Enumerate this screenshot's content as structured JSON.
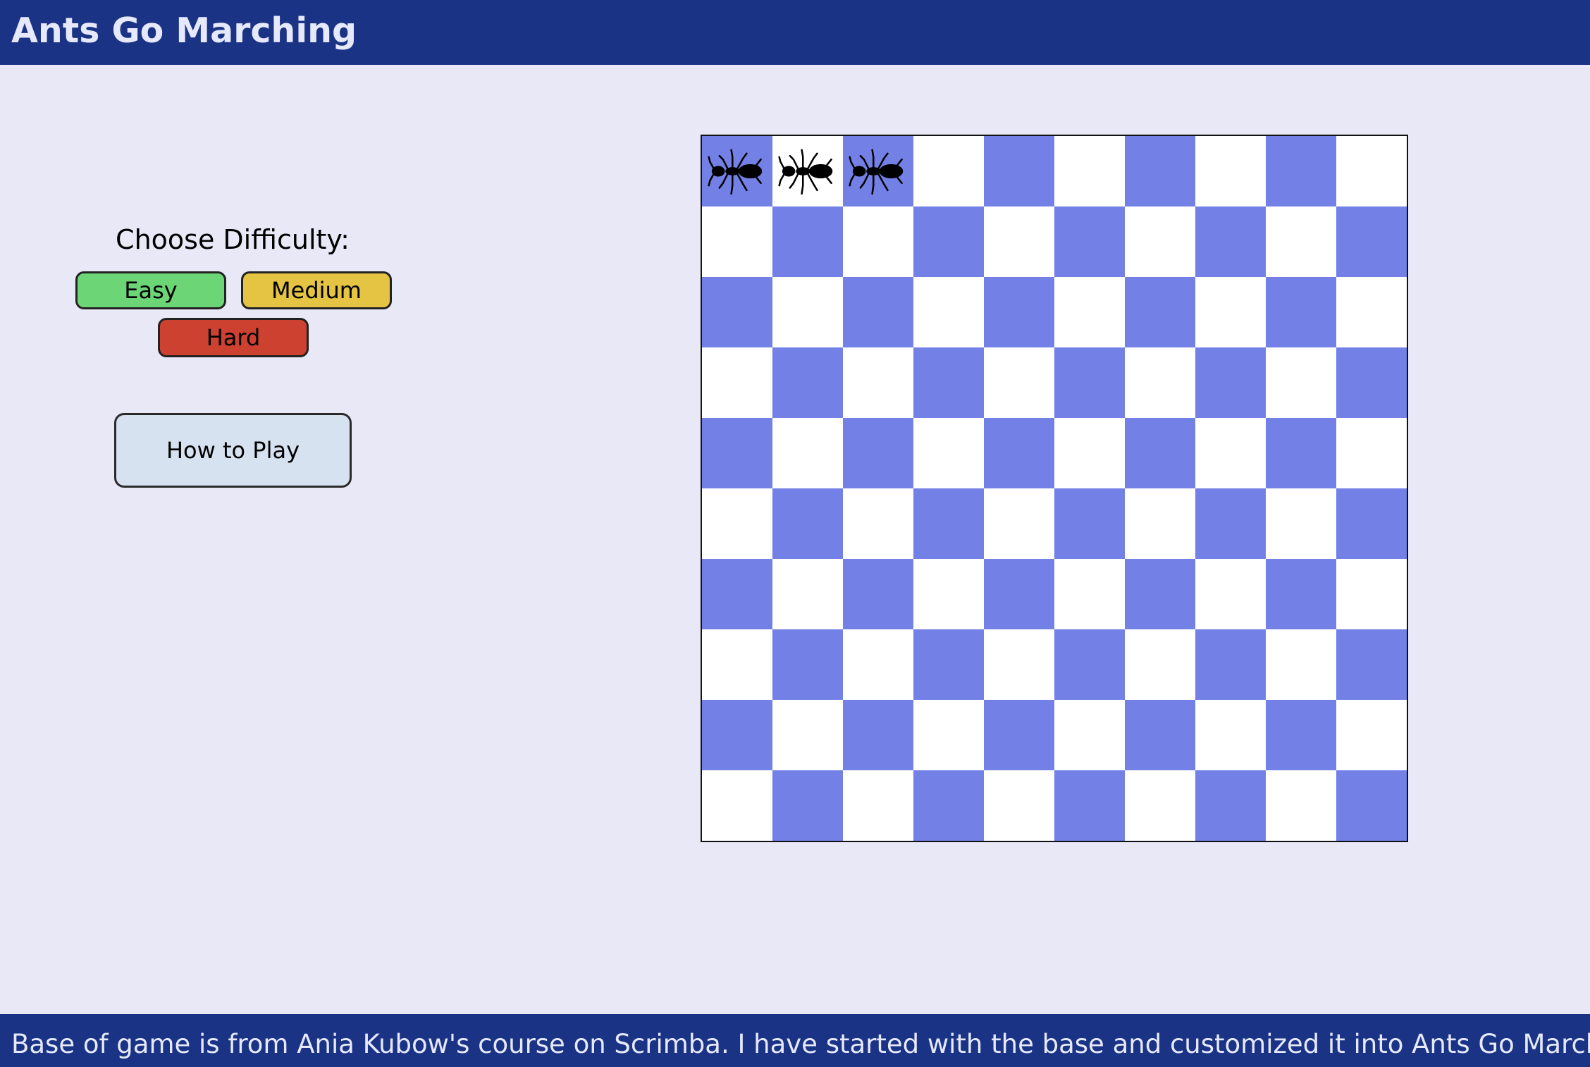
{
  "header": {
    "title": "Ants Go Marching"
  },
  "difficulty": {
    "heading": "Choose Difficulty:",
    "buttons": [
      {
        "label": "Easy",
        "color": "#6cd677"
      },
      {
        "label": "Medium",
        "color": "#e5c444"
      },
      {
        "label": "Hard",
        "color": "#cc4130"
      }
    ]
  },
  "help": {
    "label": "How to Play"
  },
  "board": {
    "rows": 10,
    "cols": 10,
    "dark_color": "#7381e6",
    "light_color": "#ffffff",
    "ants": [
      {
        "row": 0,
        "col": 0
      },
      {
        "row": 0,
        "col": 1
      },
      {
        "row": 0,
        "col": 2
      }
    ]
  },
  "footer": {
    "text": "Base of game is from Ania Kubow's course on Scrimba. I have started with the base and customized it into Ants Go Marching."
  }
}
